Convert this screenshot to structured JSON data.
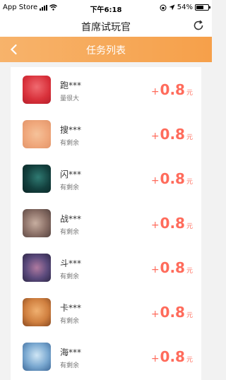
{
  "status_bar": {
    "carrier": "App Store",
    "time": "下午6:18",
    "battery": "54%",
    "battery_level": 0.54
  },
  "header": {
    "title": "首席试玩官",
    "refresh_icon": "refresh-icon"
  },
  "subheader": {
    "title": "任务列表",
    "back_icon": "chevron-left-icon"
  },
  "colors": {
    "orange": "#f6a04a",
    "price_red": "#ff6b5b"
  },
  "tasks": [
    {
      "name": "跑***",
      "status": "量很大",
      "plus": "+",
      "amount": "0.8",
      "unit": "元"
    },
    {
      "name": "搜***",
      "status": "有剩余",
      "plus": "+",
      "amount": "0.8",
      "unit": "元"
    },
    {
      "name": "闪***",
      "status": "有剩余",
      "plus": "+",
      "amount": "0.8",
      "unit": "元"
    },
    {
      "name": "战***",
      "status": "有剩余",
      "plus": "+",
      "amount": "0.8",
      "unit": "元"
    },
    {
      "name": "斗***",
      "status": "有剩余",
      "plus": "+",
      "amount": "0.8",
      "unit": "元"
    },
    {
      "name": "卡***",
      "status": "有剩余",
      "plus": "+",
      "amount": "0.8",
      "unit": "元"
    },
    {
      "name": "海***",
      "status": "有剩余",
      "plus": "+",
      "amount": "0.8",
      "unit": "元"
    }
  ]
}
